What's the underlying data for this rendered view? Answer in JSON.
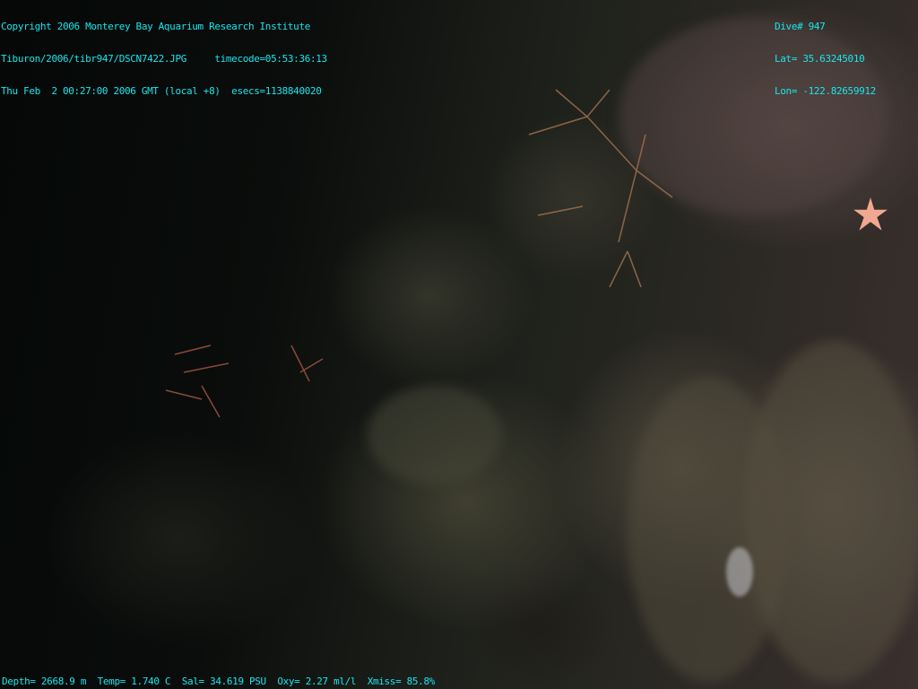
{
  "header_left": {
    "line1": "Copyright 2006 Monterey Bay Aquarium Research Institute",
    "line2": "Tiburon/2006/tibr947/DSCN7422.JPG     timecode=05:53:36:13",
    "line3": "Thu Feb  2 00:27:00 2006 GMT (local +8)  esecs=1138840020"
  },
  "header_right": {
    "dive": "Dive# 947",
    "lat": "Lat= 35.63245010",
    "lon": "Lon= -122.82659912"
  },
  "footer": {
    "sensors": "Depth= 2668.9 m  Temp= 1.740 C  Sal= 34.619 PSU  Oxy= 2.27 ml/l  Xmiss= 85.8%"
  },
  "colors": {
    "overlay_text": "#19e6ee",
    "starfish": "#f0a890"
  }
}
